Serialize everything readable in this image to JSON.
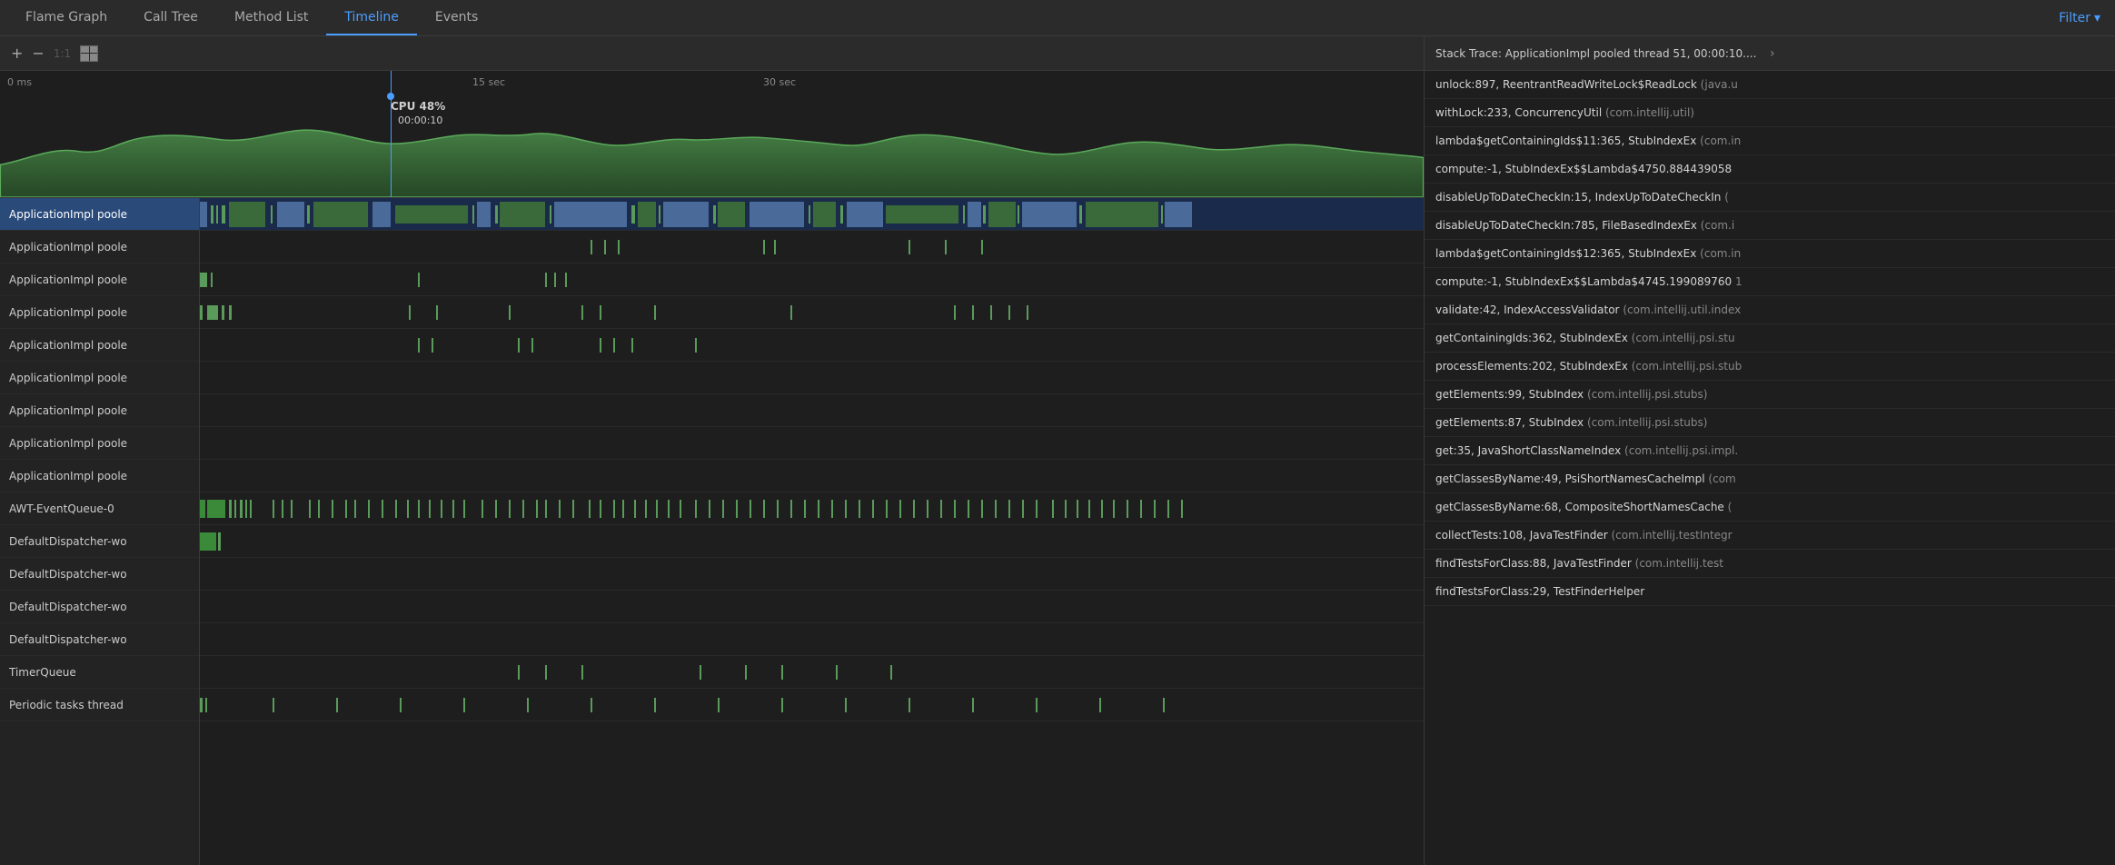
{
  "tabs": [
    {
      "label": "Flame Graph",
      "active": false
    },
    {
      "label": "Call Tree",
      "active": false
    },
    {
      "label": "Method List",
      "active": false
    },
    {
      "label": "Timeline",
      "active": true
    },
    {
      "label": "Events",
      "active": false
    }
  ],
  "filter_label": "Filter",
  "toolbar": {
    "zoom_in": "+",
    "zoom_out": "−",
    "zoom_level": "1:1",
    "grid_icon": "grid"
  },
  "chart": {
    "time_labels": [
      "0 ms",
      "15 sec",
      "30 sec"
    ],
    "cpu_label": "CPU 48%",
    "time_at_cursor": "00:00:10",
    "cursor_position_pct": 40
  },
  "threads": [
    {
      "label": "ApplicationImpl poole",
      "selected": true
    },
    {
      "label": "ApplicationImpl poole",
      "selected": false
    },
    {
      "label": "ApplicationImpl poole",
      "selected": false
    },
    {
      "label": "ApplicationImpl poole",
      "selected": false
    },
    {
      "label": "ApplicationImpl poole",
      "selected": false
    },
    {
      "label": "ApplicationImpl poole",
      "selected": false
    },
    {
      "label": "ApplicationImpl poole",
      "selected": false
    },
    {
      "label": "ApplicationImpl poole",
      "selected": false
    },
    {
      "label": "ApplicationImpl poole",
      "selected": false
    },
    {
      "label": "AWT-EventQueue-0",
      "selected": false
    },
    {
      "label": "DefaultDispatcher-wo",
      "selected": false
    },
    {
      "label": "DefaultDispatcher-wo",
      "selected": false
    },
    {
      "label": "DefaultDispatcher-wo",
      "selected": false
    },
    {
      "label": "DefaultDispatcher-wo",
      "selected": false
    },
    {
      "label": "TimerQueue",
      "selected": false
    },
    {
      "label": "Periodic tasks thread",
      "selected": false
    }
  ],
  "stack_trace": {
    "header": "Stack Trace: ApplicationImpl pooled thread 51, 00:00:10....",
    "items": [
      {
        "method": "unlock:897, ReentrantReadWriteLock$ReadLock",
        "pkg": "(java.u"
      },
      {
        "method": "withLock:233, ConcurrencyUtil",
        "pkg": "(com.intellij.util)"
      },
      {
        "method": "lambda$getContainingIds$11:365, StubIndexEx",
        "pkg": "(com.in"
      },
      {
        "method": "compute:-1, StubIndexEx$$Lambda$4750.884439058",
        "pkg": ""
      },
      {
        "method": "disableUpToDateCheckIn:15, IndexUpToDateCheckIn",
        "pkg": "("
      },
      {
        "method": "disableUpToDateCheckIn:785, FileBasedIndexEx",
        "pkg": "(com.i"
      },
      {
        "method": "lambda$getContainingIds$12:365, StubIndexEx",
        "pkg": "(com.in"
      },
      {
        "method": "compute:-1, StubIndexEx$$Lambda$4745.199089760",
        "pkg": "1"
      },
      {
        "method": "validate:42, IndexAccessValidator",
        "pkg": "(com.intellij.util.index"
      },
      {
        "method": "getContainingIds:362, StubIndexEx",
        "pkg": "(com.intellij.psi.stu"
      },
      {
        "method": "processElements:202, StubIndexEx",
        "pkg": "(com.intellij.psi.stub"
      },
      {
        "method": "getElements:99, StubIndex",
        "pkg": "(com.intellij.psi.stubs)"
      },
      {
        "method": "getElements:87, StubIndex",
        "pkg": "(com.intellij.psi.stubs)"
      },
      {
        "method": "get:35, JavaShortClassNameIndex",
        "pkg": "(com.intellij.psi.impl."
      },
      {
        "method": "getClassesByName:49, PsiShortNamesCacheImpl",
        "pkg": "(com"
      },
      {
        "method": "getClassesByName:68, CompositeShortNamesCache",
        "pkg": "("
      },
      {
        "method": "collectTests:108, JavaTestFinder",
        "pkg": "(com.intellij.testIntegr"
      },
      {
        "method": "findTestsForClass:88, JavaTestFinder",
        "pkg": "(com.intellij.test"
      },
      {
        "method": "findTestsForClass:29, TestFinderHelper",
        "pkg": ""
      }
    ]
  }
}
